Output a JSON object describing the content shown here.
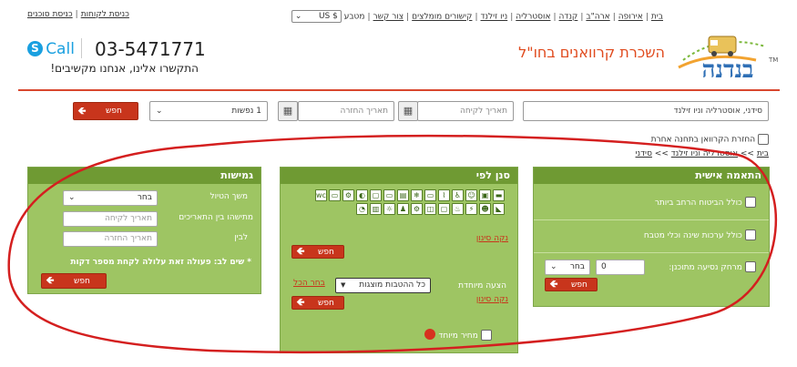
{
  "top_nav": {
    "links": [
      "בית",
      "אירופה",
      "ארה\"ב",
      "קנדה",
      "אוסטרליה",
      "ניו זילנד",
      "קישורים מומלצים",
      "צור קשר"
    ],
    "currency_label": "מטבע",
    "currency_value": "US $",
    "agents_login": "כניסת סוכנים",
    "customers_login": "כניסת לקוחות"
  },
  "logo": {
    "brand": "בנדנה",
    "tm": "TM",
    "tagline": "השכרת קרוואנים בחו\"ל"
  },
  "contact": {
    "phone": "03-5471771",
    "skype_label": "Call",
    "subtitle": "התקשרו אלינו, אנחנו מקשיבים!"
  },
  "search": {
    "destination_value": "סידני, אוסטרליה וניו זילנד",
    "pickup_placeholder": "תאריך לקיחה",
    "return_placeholder": "תאריך החזרה",
    "passengers_value": "1 נפשות",
    "search_label": "חפש"
  },
  "return_other_city": "החזרת הקרוואן בתחנה אחרת",
  "breadcrumb": {
    "home": "בית",
    "sep": ">>",
    "middle": "אוסטרליה וניו זילנד",
    "current": "סידני"
  },
  "panels": {
    "personal": {
      "title": "התאמה אישית",
      "opt1": "כולל הביטוח הרחב ביותר",
      "opt2": "כולל ערכות שינה וכלי מטבח",
      "distance_label": "מרחק נסיעה מתוכנן:",
      "distance_value": "0",
      "unit_value": "בחר",
      "search_label": "חפש"
    },
    "filter": {
      "title": "סנן לפי",
      "clear_filter": "נקה סינון",
      "search_label": "חפש",
      "special_offer_label": "הצעה מיוחדת",
      "all_offers": "כל ההטבות מוצגות",
      "select_all": "בחר הכל",
      "clear_filter2": "נקה סינון",
      "search_label2": "חפש",
      "special_price": "מחיר מיוחד",
      "icons": [
        "car-icon",
        "bus-icon",
        "family-icon",
        "wheelchair-icon",
        "shower-icon",
        "sofa-icon",
        "ac-icon",
        "kitchen-icon",
        "bed-icon",
        "tv-icon",
        "gas-icon",
        "bike-icon",
        "bed2-icon",
        "wc-icon",
        "awning-icon",
        "kids-icon",
        "power-icon",
        "heater-icon",
        "window-icon",
        "dining-icon",
        "4wd-icon",
        "kids2-icon",
        "solar-icon",
        "fridge-icon",
        "pets-icon"
      ],
      "icon_glyphs": [
        "▬",
        "▣",
        "☺",
        "♿",
        "⌇",
        "▭",
        "❄",
        "▤",
        "▭",
        "▢",
        "◐",
        "⚙",
        "▭",
        "wc",
        "◣",
        "☻",
        "⚡",
        "♨",
        "▢",
        "◫",
        "⚙",
        "♟",
        "☼",
        "▥",
        "◔"
      ]
    },
    "flex": {
      "title": "גמישות",
      "duration_label": "משך הטיול",
      "duration_value": "בחר",
      "between_label": "מתישהו בין התאריכים",
      "pickup_placeholder": "תאריך לקיחה",
      "and_label": "לבין",
      "return_placeholder": "תאריך החזרה",
      "note": "* שים לב: פעולה זאת עלולה לקחת מספר דקות",
      "search_label": "חפש"
    }
  },
  "colors": {
    "accent_red": "#c8351c",
    "panel_green": "#9ec563",
    "panel_head": "#6f9a33",
    "brand_blue": "#2f6fb5",
    "tagline_orange": "#e04a1d",
    "annotation_red": "#d41f1f"
  }
}
